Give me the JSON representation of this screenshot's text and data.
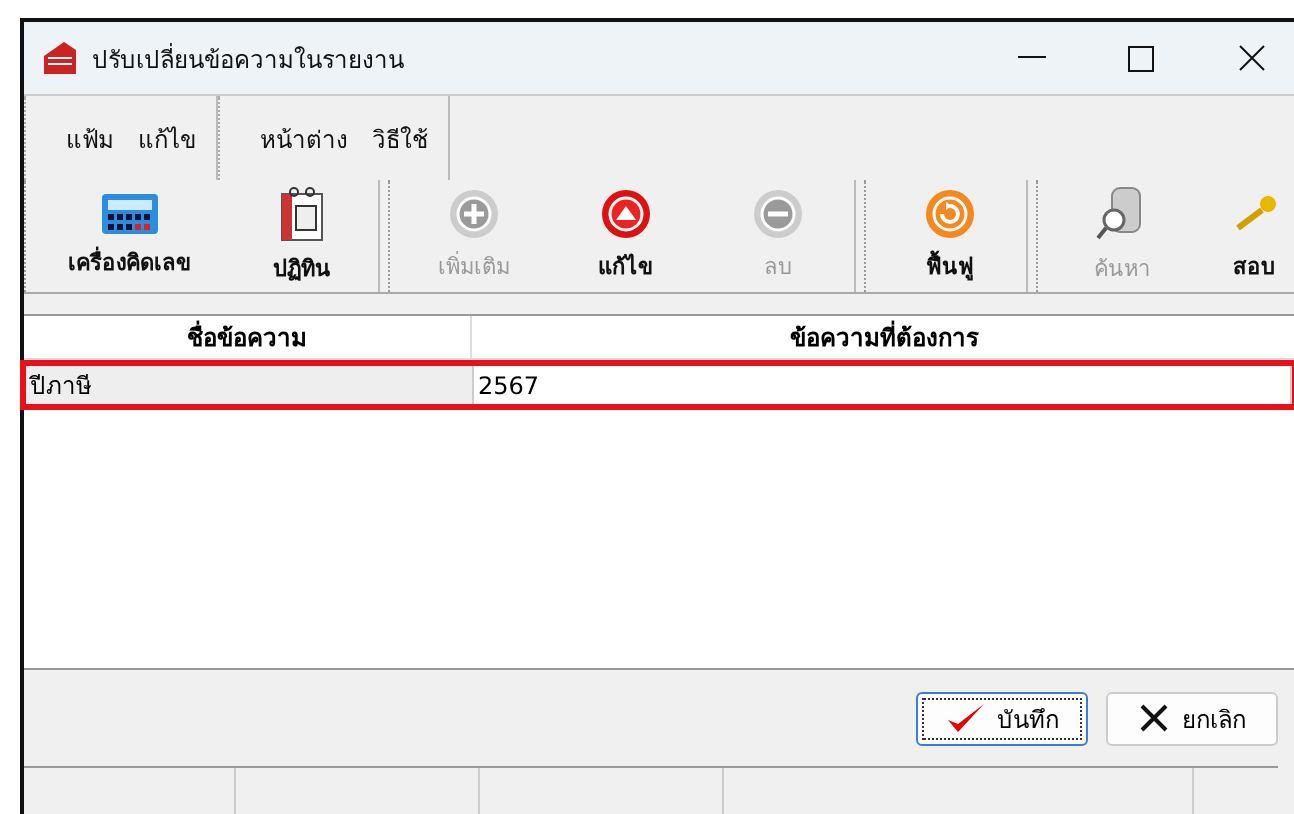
{
  "window": {
    "title": "ปรับเปลี่ยนข้อความในรายงาน"
  },
  "menu_groups": [
    [
      "แฟ้ม",
      "แก้ไข"
    ],
    [
      "หน้าต่าง",
      "วิธีใช้"
    ]
  ],
  "toolbar_groups": [
    [
      {
        "label": "เครื่องคิดเลข",
        "disabled": false
      },
      {
        "label": "ปฏิทิน",
        "disabled": false
      }
    ],
    [
      {
        "label": "เพิ่มเติม",
        "disabled": true
      },
      {
        "label": "แก้ไข",
        "disabled": false
      },
      {
        "label": "ลบ",
        "disabled": true
      }
    ],
    [
      {
        "label": "ฟื้นฟู",
        "disabled": false
      }
    ],
    [
      {
        "label": "ค้นหา",
        "disabled": true
      },
      {
        "label": "สอบ",
        "disabled": false
      }
    ]
  ],
  "table": {
    "columns": [
      "ชื่อข้อความ",
      "ข้อความที่ต้องการ"
    ],
    "rows": [
      {
        "cells": [
          "ปีภาษี",
          "2567"
        ],
        "highlighted": true
      }
    ]
  },
  "buttons": [
    {
      "label": "บันทึก",
      "kind": "ok",
      "focused": true
    },
    {
      "label": "ยกเลิก",
      "kind": "cancel",
      "focused": false
    }
  ]
}
